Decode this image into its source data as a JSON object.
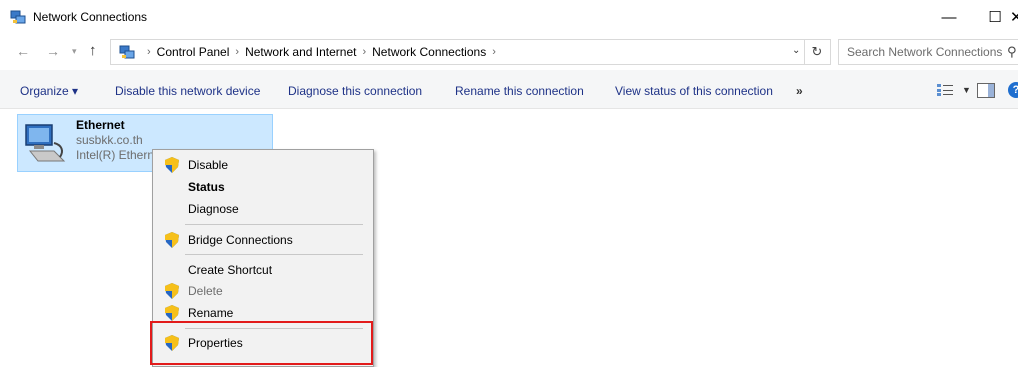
{
  "window": {
    "title": "Network Connections",
    "controls": {
      "minimize": "—",
      "maximize": "☐",
      "close": "✕"
    }
  },
  "address": {
    "crumbs": [
      "Control Panel",
      "Network and Internet",
      "Network Connections"
    ],
    "separator": "›",
    "search_placeholder": "Search Network Connections"
  },
  "commands": {
    "organize": "Organize ▾",
    "disable": "Disable this network device",
    "diagnose": "Diagnose this connection",
    "rename": "Rename this connection",
    "view_status": "View status of this connection",
    "more": "»"
  },
  "connection": {
    "name": "Ethernet",
    "domain": "susbkk.co.th",
    "adapter": "Intel(R) Ethern"
  },
  "context_menu": {
    "items": [
      {
        "label": "Disable",
        "shield": true
      },
      {
        "label": "Status",
        "bold": true
      },
      {
        "label": "Diagnose"
      },
      {
        "label": "Bridge Connections",
        "shield": true
      },
      {
        "label": "Create Shortcut"
      },
      {
        "label": "Delete",
        "shield": true,
        "disabled": true
      },
      {
        "label": "Rename",
        "shield": true
      },
      {
        "label": "Properties",
        "shield": true
      }
    ]
  },
  "colors": {
    "accent_link": "#1e3287",
    "selection_bg": "#cce8ff",
    "highlight_border": "#e21b1b"
  }
}
